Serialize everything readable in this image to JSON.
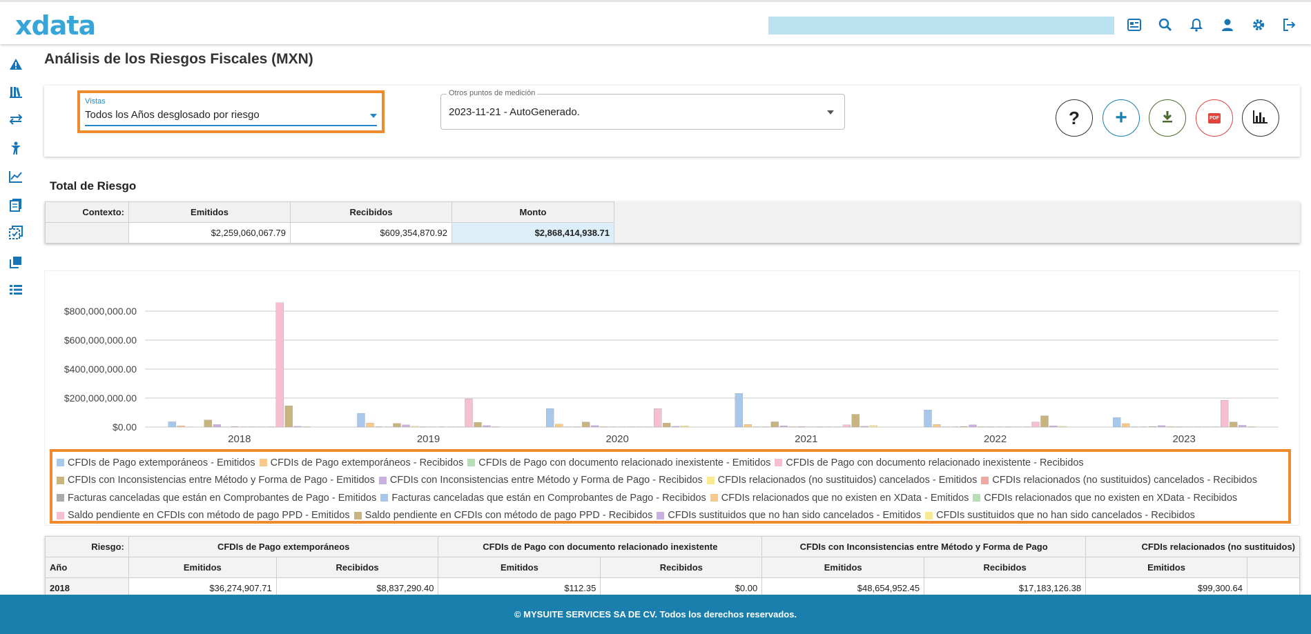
{
  "app": {
    "logo": "xdata"
  },
  "header": {
    "icons": [
      "news-icon",
      "search-icon",
      "bell-icon",
      "user-icon",
      "gear-icon",
      "logout-icon"
    ]
  },
  "sidebar": {
    "icons": [
      "alert-icon",
      "books-icon",
      "transfer-icon",
      "person-icon",
      "trend-icon",
      "document-icon",
      "audit-icon",
      "copy-icon",
      "list-icon"
    ]
  },
  "page": {
    "title": "Análisis de los Riesgos Fiscales (MXN)"
  },
  "filters": {
    "vistas_label": "Vistas",
    "vistas_value": "Todos los Años desglosado por riesgo",
    "otros_label": "Otros puntos de medición",
    "otros_value": "2023-11-21 - AutoGenerado."
  },
  "actions": {
    "help_label": "?",
    "add_label": "+",
    "pdf_label": "PDF"
  },
  "colors": {
    "accent": "#1a7fac",
    "highlight": "#f08a2e"
  },
  "total": {
    "title": "Total de Riesgo",
    "context_label": "Contexto:",
    "headers": [
      "Emitidos",
      "Recibidos",
      "Monto"
    ],
    "values": [
      "$2,259,060,067.79",
      "$609,354,870.92",
      "$2,868,414,938.71"
    ]
  },
  "chart_data": {
    "type": "bar",
    "categories": [
      "2018",
      "2019",
      "2020",
      "2021",
      "2022",
      "2023"
    ],
    "y_ticks": [
      "$0.00",
      "$200,000,000.00",
      "$400,000,000.00",
      "$600,000,000.00",
      "$800,000,000.00"
    ],
    "ylim": [
      0,
      900000000
    ],
    "series": [
      {
        "name": "CFDIs de Pago extemporáneos - Emitidos",
        "color": "#a7c8ea",
        "values": [
          36274907.71,
          95000000,
          128000000,
          232000000,
          118000000,
          65000000
        ]
      },
      {
        "name": "CFDIs de Pago extemporáneos - Recibidos",
        "color": "#f7c98b",
        "values": [
          8837290.4,
          28000000,
          20000000,
          18000000,
          18000000,
          24000000
        ]
      },
      {
        "name": "CFDIs de Pago con documento relacionado inexistente - Emitidos",
        "color": "#b6dfb6",
        "values": [
          112.35,
          3000000,
          2000000,
          2000000,
          2000000,
          2000000
        ]
      },
      {
        "name": "CFDIs de Pago con documento relacionado inexistente - Recibidos",
        "color": "#f5bfd0",
        "values": [
          0,
          2000000,
          2000000,
          2000000,
          2000000,
          2000000
        ]
      },
      {
        "name": "CFDIs con Inconsistencias entre Método y Forma de Pago - Emitidos",
        "color": "#c7b47f",
        "values": [
          48654952.45,
          25000000,
          35000000,
          36000000,
          4000000,
          3000000
        ]
      },
      {
        "name": "CFDIs con Inconsistencias entre Método y Forma de Pago - Recibidos",
        "color": "#c9b0e0",
        "values": [
          17183126.38,
          15000000,
          10000000,
          8000000,
          15000000,
          10000000
        ]
      },
      {
        "name": "CFDIs relacionados (no sustituidos) cancelados - Emitidos",
        "color": "#f7ea92",
        "values": [
          99300.64,
          5000000,
          4000000,
          4000000,
          4000000,
          4000000
        ]
      },
      {
        "name": "CFDIs relacionados (no sustituidos) cancelados - Recibidos",
        "color": "#f2a79f",
        "values": [
          3000000,
          2000000,
          2000000,
          3000000,
          2000000,
          2000000
        ]
      },
      {
        "name": "Facturas canceladas que están en Comprobantes de Pago - Emitidos",
        "color": "#aaaaaa",
        "values": [
          1000000,
          1000000,
          1000000,
          1000000,
          1000000,
          1000000
        ]
      },
      {
        "name": "Facturas canceladas que están en Comprobantes de Pago - Recibidos",
        "color": "#a7c8ea",
        "values": [
          2000000,
          2000000,
          2000000,
          2000000,
          2000000,
          2000000
        ]
      },
      {
        "name": "CFDIs relacionados que no existen en XData - Emitidos",
        "color": "#f7c98b",
        "values": [
          1000000,
          1000000,
          1000000,
          1000000,
          1000000,
          1000000
        ]
      },
      {
        "name": "CFDIs relacionados que no existen en XData - Recibidos",
        "color": "#b6dfb6",
        "values": [
          1000000,
          1000000,
          1000000,
          1000000,
          1000000,
          1000000
        ]
      },
      {
        "name": "Saldo pendiente en CFDIs con método de pago PPD - Emitidos",
        "color": "#f5bfd0",
        "values": [
          858000000,
          195000000,
          127000000,
          15000000,
          35000000,
          185000000
        ]
      },
      {
        "name": "Saldo pendiente en CFDIs con método de pago PPD - Recibidos",
        "color": "#c7b47f",
        "values": [
          147000000,
          32000000,
          27000000,
          88000000,
          78000000,
          35000000
        ]
      },
      {
        "name": "CFDIs sustituidos que no han sido cancelados - Emitidos",
        "color": "#c9b0e0",
        "values": [
          5000000,
          10000000,
          5000000,
          5000000,
          8000000,
          12000000
        ]
      },
      {
        "name": "CFDIs sustituidos que no han sido cancelados - Recibidos",
        "color": "#f7ea92",
        "values": [
          3000000,
          3000000,
          8000000,
          10000000,
          5000000,
          3000000
        ]
      }
    ],
    "legend_rows": [
      [
        0,
        1,
        2,
        3
      ],
      [
        4,
        5,
        6,
        7
      ],
      [
        8,
        9,
        10,
        11
      ],
      [
        12,
        13,
        14,
        15
      ]
    ]
  },
  "breakdown": {
    "riesgo_label": "Riesgo:",
    "groups": [
      "CFDIs de Pago extemporáneos",
      "CFDIs de Pago con documento relacionado inexistente",
      "CFDIs con Inconsistencias entre Método y Forma de Pago",
      "CFDIs relacionados (no sustituidos)"
    ],
    "year_label": "Año",
    "sub_headers": [
      "Emitidos",
      "Recibidos",
      "Emitidos",
      "Recibidos",
      "Emitidos",
      "Recibidos",
      "Emitidos"
    ],
    "rows": [
      {
        "year": "2018",
        "values": [
          "$36,274,907.71",
          "$8,837,290.40",
          "$112.35",
          "$0.00",
          "$48,654,952.45",
          "$17,183,126.38",
          "$99,300.64"
        ]
      }
    ]
  },
  "footer": {
    "text": "© MYSUITE SERVICES SA DE CV. Todos los derechos reservados."
  }
}
